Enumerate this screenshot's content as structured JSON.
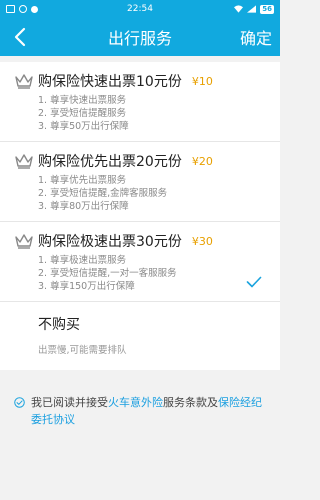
{
  "status_bar": {
    "time": "22:54",
    "battery": "56"
  },
  "nav": {
    "title": "出行服务",
    "confirm_label": "确定",
    "back_icon": "chevron-left-icon"
  },
  "colors": {
    "brand": "#11a9df",
    "price": "#e8a000",
    "link": "#1a9fe0"
  },
  "options": [
    {
      "title": "购保险快速出票10元份",
      "price": "¥10",
      "lines": [
        "1. 尊享快速出票服务",
        "2. 享受短信提醒服务",
        "3. 尊享50万出行保障"
      ],
      "selected": false
    },
    {
      "title": "购保险优先出票20元份",
      "price": "¥20",
      "lines": [
        "1. 尊享优先出票服务",
        "2. 享受短信提醒,金牌客服服务",
        "3. 尊享80万出行保障"
      ],
      "selected": false
    },
    {
      "title": "购保险极速出票30元份",
      "price": "¥30",
      "lines": [
        "1. 尊享极速出票服务",
        "2. 享受短信提醒,一对一客服服务",
        "3. 尊享150万出行保障"
      ],
      "selected": true
    }
  ],
  "no_purchase": {
    "title": "不购买",
    "subtitle": "出票慢,可能需要排队"
  },
  "agreement": {
    "prefix": "我已阅读并接受",
    "link1": "火车意外险",
    "middle": "服务条款及",
    "link2": "保险经纪委托协议",
    "checked": true
  }
}
